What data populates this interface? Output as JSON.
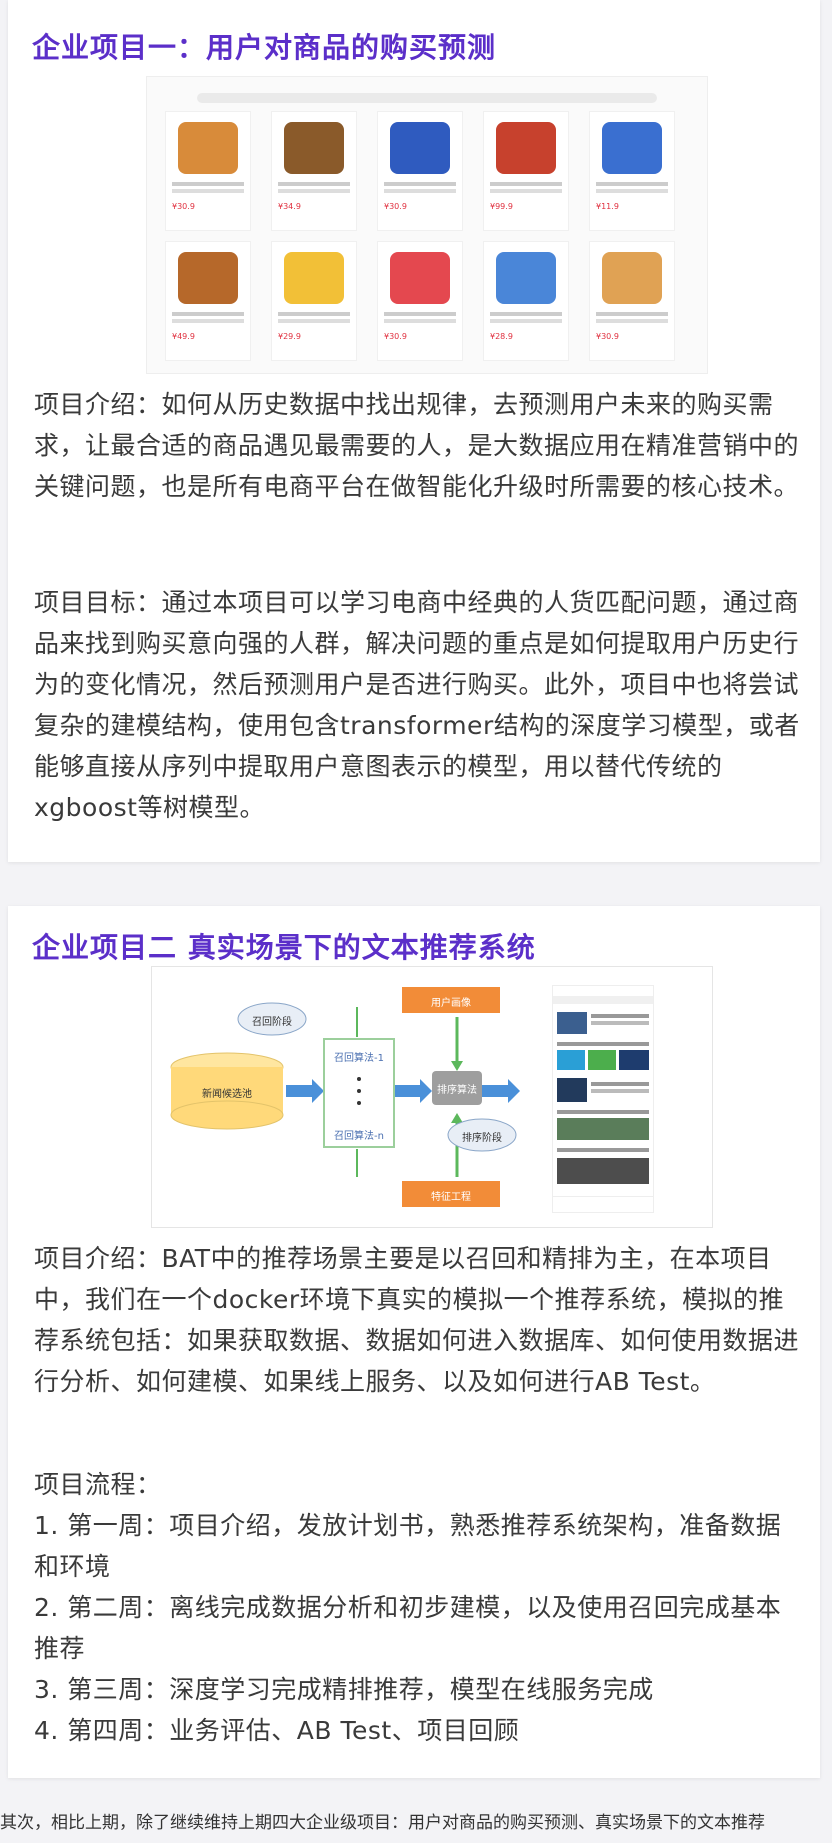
{
  "project1": {
    "title": "企业项目一：用户对商品的购买预测",
    "products": [
      {
        "price": "¥30.9",
        "color": "#d88b3a"
      },
      {
        "price": "¥34.9",
        "color": "#8a5a2a"
      },
      {
        "price": "¥30.9",
        "color": "#2f5bbf"
      },
      {
        "price": "¥99.9",
        "color": "#c7412d"
      },
      {
        "price": "¥11.9",
        "color": "#3a6fd0"
      },
      {
        "price": "¥49.9",
        "color": "#b6682a"
      },
      {
        "price": "¥29.9",
        "color": "#f2c037"
      },
      {
        "price": "¥30.9",
        "color": "#e4484f"
      },
      {
        "price": "¥28.9",
        "color": "#4a86d8"
      },
      {
        "price": "¥30.9",
        "color": "#e0a254"
      }
    ],
    "intro": "项目介绍：如何从历史数据中找出规律，去预测用户未来的购买需求，让最合适的商品遇见最需要的人，是大数据应用在精准营销中的关键问题，也是所有电商平台在做智能化升级时所需要的核心技术。",
    "goal": "项目目标：通过本项目可以学习电商中经典的人货匹配问题，通过商品来找到购买意向强的人群，解决问题的重点是如何提取用户历史行为的变化情况，然后预测用户是否进行购买。此外，项目中也将尝试复杂的建模结构，使用包含transformer结构的深度学习模型，或者能够直接从序列中提取用户意图表示的模型，用以替代传统的xgboost等树模型。"
  },
  "project2": {
    "title": "企业项目二  真实场景下的文本推荐系统",
    "diagram": {
      "user_profile": "用户画像",
      "recall_stage": "召回阶段",
      "news_pool": "新闻候选池",
      "recall_algo_1": "召回算法-1",
      "recall_algo_n": "召回算法-n",
      "rank_algo": "排序算法",
      "rank_stage": "排序阶段",
      "feature_eng": "特征工程"
    },
    "intro": "项目介绍：BAT中的推荐场景主要是以召回和精排为主，在本项目中，我们在一个docker环境下真实的模拟一个推荐系统，模拟的推荐系统包括：如果获取数据、数据如何进入数据库、如何使用数据进行分析、如何建模、如果线上服务、以及如何进行AB Test。",
    "flow_title": "项目流程：",
    "flow": [
      "1. 第一周：项目介绍，发放计划书，熟悉推荐系统架构，准备数据和环境",
      "2.  第二周：离线完成数据分析和初步建模，以及使用召回完成基本推荐",
      "3. 第三周：深度学习完成精排推荐，模型在线服务完成",
      "4. 第四周：业务评估、AB Test、项目回顾"
    ]
  },
  "caption": "其次，相比上期，除了继续维持上期四大企业级项目：用户对商品的购买预测、真实场景下的文本推荐"
}
